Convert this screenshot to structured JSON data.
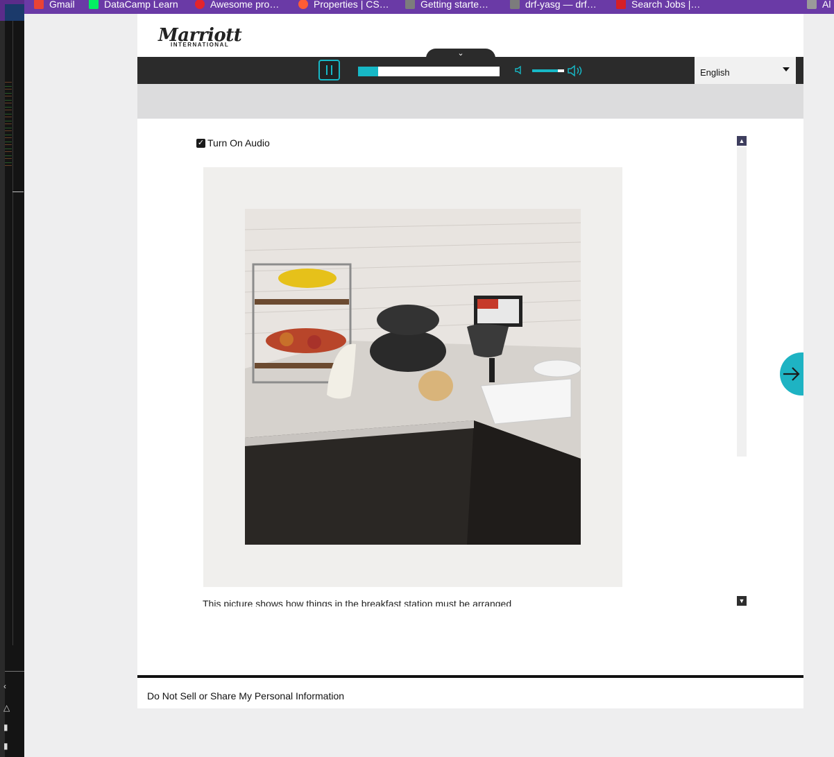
{
  "bookmarks": [
    {
      "label": "Gmail",
      "color": "#ea4335"
    },
    {
      "label": "DataCamp Learn",
      "color": "#03ef62"
    },
    {
      "label": "Awesome pro…",
      "color": "#e3242b"
    },
    {
      "label": "Properties | CS…",
      "color": "#ff5c35"
    },
    {
      "label": "Getting starte…",
      "color": "#7c7c7c"
    },
    {
      "label": "drf-yasg — drf…",
      "color": "#7c7c7c"
    },
    {
      "label": "Search Jobs |…",
      "color": "#d61f26"
    },
    {
      "label": "Al",
      "color": "#9a9a9a"
    }
  ],
  "header": {
    "logo_text": "Marriott",
    "logo_sub": "INTERNATIONAL"
  },
  "player": {
    "collapse_icon": "chevron-down-icon",
    "pause_icon": "pause-icon",
    "progress_percent": 14,
    "mute_icon": "speaker-mute-icon",
    "volume_percent": 80,
    "volume_icon": "speaker-loud-icon",
    "language": "English",
    "accent": "#17b8c6"
  },
  "content": {
    "audio_checkbox_label": "Turn On Audio",
    "audio_checked": true,
    "caption": "This picture shows how things in the breakfast station must be arranged"
  },
  "navigation": {
    "next_icon": "arrow-right-icon"
  },
  "footer": {
    "link": "Do Not Sell or Share My Personal Information"
  }
}
